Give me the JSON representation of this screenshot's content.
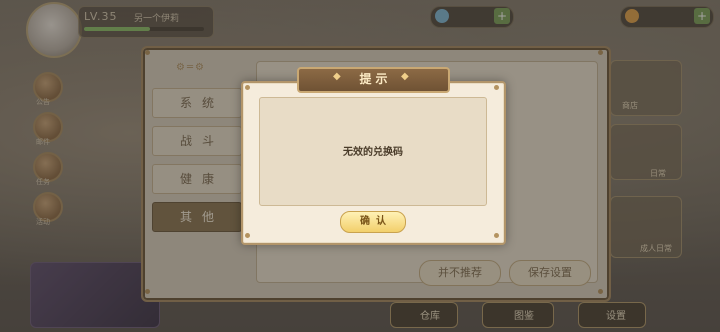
{
  "hud": {
    "level_text": "LV.35",
    "player_name": "另一个伊莉",
    "exp_fraction": 0.55,
    "resource_1": "",
    "resource_2": "",
    "side_buttons": [
      "公告",
      "邮件",
      "任务",
      "活动"
    ]
  },
  "right_cards": [
    "商店",
    "日常",
    "成人日常"
  ],
  "bottom_nav": [
    "仓库",
    "图鉴",
    "设置"
  ],
  "settings": {
    "tabs": [
      {
        "label": "系统",
        "active": false
      },
      {
        "label": "战斗",
        "active": false
      },
      {
        "label": "健康",
        "active": false
      },
      {
        "label": "其他",
        "active": true
      }
    ],
    "reset_label": "并不推荐",
    "save_label": "保存设置"
  },
  "dialog": {
    "title": "提示",
    "message": "无效的兑换码",
    "confirm_label": "确认"
  },
  "colors": {
    "accent_gold": "#f2cf6b",
    "header_brown": "#7a5a3a",
    "exp_green": "#8cbf6a"
  }
}
